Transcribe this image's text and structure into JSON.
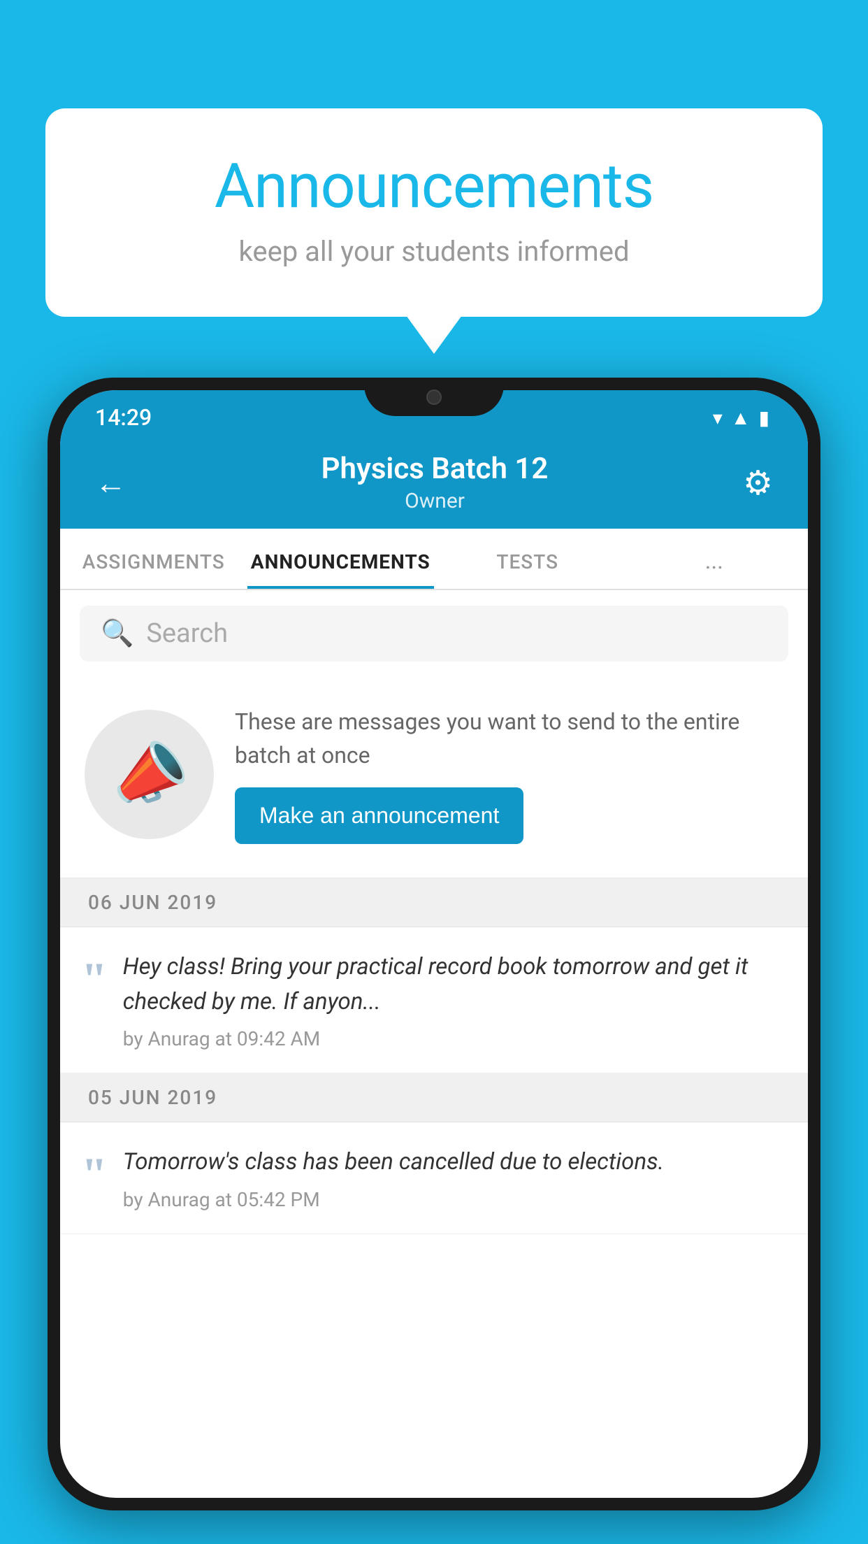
{
  "background_color": "#1ab8e8",
  "speech_bubble": {
    "title": "Announcements",
    "subtitle": "keep all your students informed"
  },
  "phone": {
    "status_bar": {
      "time": "14:29",
      "icons": [
        "wifi",
        "signal",
        "battery"
      ]
    },
    "header": {
      "title": "Physics Batch 12",
      "subtitle": "Owner",
      "back_label": "←",
      "gear_label": "⚙"
    },
    "tabs": [
      {
        "label": "ASSIGNMENTS",
        "active": false
      },
      {
        "label": "ANNOUNCEMENTS",
        "active": true
      },
      {
        "label": "TESTS",
        "active": false
      },
      {
        "label": "...",
        "active": false
      }
    ],
    "search": {
      "placeholder": "Search"
    },
    "promo": {
      "description": "These are messages you want to send to the entire batch at once",
      "button_label": "Make an announcement"
    },
    "announcements": [
      {
        "date": "06  JUN  2019",
        "message": "Hey class! Bring your practical record book tomorrow and get it checked by me. If anyon...",
        "meta": "by Anurag at 09:42 AM"
      },
      {
        "date": "05  JUN  2019",
        "message": "Tomorrow's class has been cancelled due to elections.",
        "meta": "by Anurag at 05:42 PM"
      }
    ]
  }
}
